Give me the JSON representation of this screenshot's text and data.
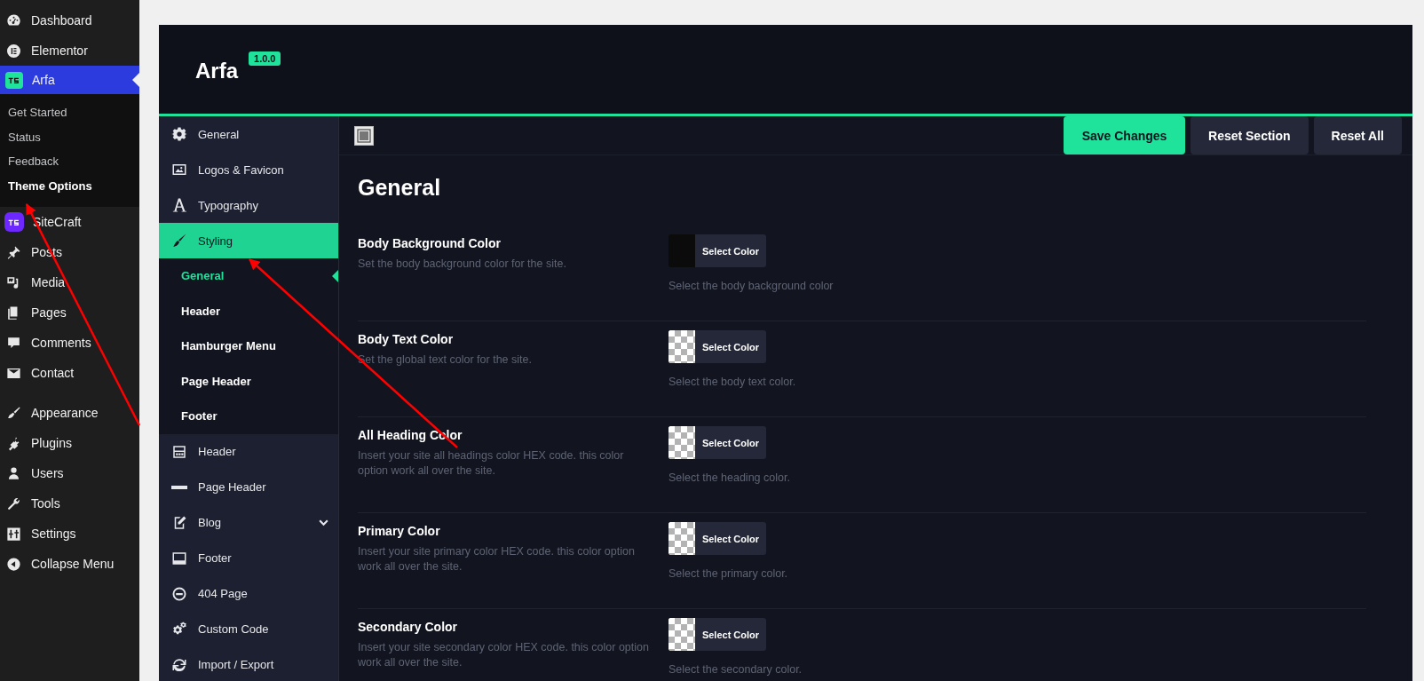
{
  "admin_menu": {
    "groups": [
      [
        {
          "label": "Dashboard",
          "selected": false
        },
        {
          "label": "Elementor",
          "selected": false
        },
        {
          "label": "Arfa",
          "selected": true,
          "children": [
            {
              "label": "Get Started",
              "selected": false
            },
            {
              "label": "Status",
              "selected": false
            },
            {
              "label": "Feedback",
              "selected": false
            },
            {
              "label": "Theme Options",
              "selected": true
            }
          ]
        },
        {
          "label": "SiteCraft",
          "selected": false
        },
        {
          "label": "Posts",
          "selected": false
        },
        {
          "label": "Media",
          "selected": false
        },
        {
          "label": "Pages",
          "selected": false
        },
        {
          "label": "Comments",
          "selected": false
        },
        {
          "label": "Contact",
          "selected": false
        }
      ],
      [
        {
          "label": "Appearance",
          "selected": false
        },
        {
          "label": "Plugins",
          "selected": false
        },
        {
          "label": "Users",
          "selected": false
        },
        {
          "label": "Tools",
          "selected": false
        },
        {
          "label": "Settings",
          "selected": false
        },
        {
          "label": "Collapse Menu",
          "selected": false
        }
      ]
    ]
  },
  "panel": {
    "title": "Arfa",
    "version": "1.0.0"
  },
  "options_nav": [
    {
      "label": "General",
      "selected": false
    },
    {
      "label": "Logos & Favicon",
      "selected": false
    },
    {
      "label": "Typography",
      "selected": false
    },
    {
      "label": "Styling",
      "selected": true,
      "expanded": true,
      "children": [
        {
          "label": "General",
          "selected": true
        },
        {
          "label": "Header",
          "selected": false
        },
        {
          "label": "Hamburger Menu",
          "selected": false
        },
        {
          "label": "Page Header",
          "selected": false
        },
        {
          "label": "Footer",
          "selected": false
        }
      ]
    },
    {
      "label": "Header",
      "selected": false
    },
    {
      "label": "Page Header",
      "selected": false
    },
    {
      "label": "Blog",
      "selected": false,
      "expanded": false
    },
    {
      "label": "Footer",
      "selected": false
    },
    {
      "label": "404 Page",
      "selected": false
    },
    {
      "label": "Custom Code",
      "selected": false
    },
    {
      "label": "Import / Export",
      "selected": false
    }
  ],
  "toolbar": {
    "buttons": [
      {
        "label": "Save Changes",
        "kind": "primary"
      },
      {
        "label": "Reset Section",
        "kind": "secondary"
      },
      {
        "label": "Reset All",
        "kind": "secondary"
      }
    ]
  },
  "section": {
    "title": "General",
    "fields": [
      {
        "label": "Body Background Color",
        "description": "Set the body background color for the site.",
        "button": "Select Color",
        "help": "Select the body background color",
        "kind": "solid",
        "color": "#0b0b0b"
      },
      {
        "label": "Body Text Color",
        "description": "Set the global text color for the site.",
        "button": "Select Color",
        "help": "Select the body text color.",
        "kind": "transparent"
      },
      {
        "label": "All Heading Color",
        "description": "Insert your site all headings color HEX code. this color option work all over the site.",
        "button": "Select Color",
        "help": "Select the heading color.",
        "kind": "transparent"
      },
      {
        "label": "Primary Color",
        "description": "Insert your site primary color HEX code. this color option work all over the site.",
        "button": "Select Color",
        "help": "Select the primary color.",
        "kind": "transparent"
      },
      {
        "label": "Secondary Color",
        "description": "Insert your site secondary color HEX code. this color option work all over the site.",
        "button": "Select Color",
        "help": "Select the secondary color.",
        "kind": "transparent"
      }
    ]
  }
}
